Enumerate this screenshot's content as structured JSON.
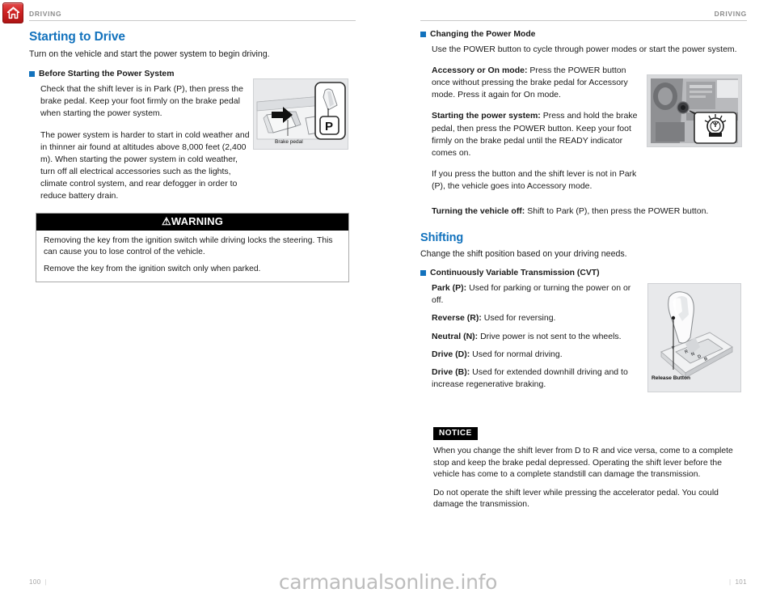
{
  "home_button": {
    "icon": "home-icon",
    "color": "#cf2222"
  },
  "accent_color": "#1272bd",
  "left_page": {
    "running_head": "DRIVING",
    "title": "Starting to Drive",
    "lead": "Turn on the vehicle and start the power system to begin driving.",
    "subsection": {
      "heading": "Before Starting the Power System",
      "paragraphs": [
        "Check that the shift lever is in Park (P), then press the brake pedal. Keep your foot firmly on the brake pedal when starting the power system.",
        "The power system is harder to start in cold weather and in thinner air found at altitudes above 8,000 feet (2,400 m). When starting the power system in cold weather, turn off all electrical accessories such as the lights, climate control system, and rear defogger in order to reduce battery drain."
      ]
    },
    "figure": {
      "name": "brake-pedal-illustration",
      "caption": "Brake pedal",
      "inset_label": "P"
    },
    "warning": {
      "label": "WARNING",
      "symbol": "⚠",
      "paragraphs": [
        "Removing the key from the ignition switch while driving locks the steering. This can cause you to lose control of the vehicle.",
        "Remove the key from the ignition switch only when parked."
      ]
    },
    "page_number": "100"
  },
  "right_page": {
    "running_head": "DRIVING",
    "power_mode": {
      "heading": "Changing the Power Mode",
      "lead": "Use the POWER button to cycle through power modes or start the power system.",
      "items": [
        {
          "term": "Accessory or On mode:",
          "text": " Press the POWER button once without pressing the brake pedal for Accessory mode. Press it again for On mode."
        },
        {
          "term": "Starting the power system:",
          "text": " Press and hold the brake pedal, then press the POWER button. Keep your foot firmly on the brake pedal until the READY indicator comes on."
        }
      ],
      "note": "If you press the button and the shift lever is not in Park (P), the vehicle goes into Accessory mode.",
      "turning_off": {
        "term": "Turning the vehicle off:",
        "text": " Shift to Park (P), then press the POWER button."
      },
      "figure": {
        "name": "power-button-dashboard-photo"
      }
    },
    "shifting": {
      "title": "Shifting",
      "lead": "Change the shift position based on your driving needs.",
      "heading": "Continuously Variable Transmission (CVT)",
      "positions": [
        {
          "term": "Park (P):",
          "text": " Used for parking or turning the power on or off."
        },
        {
          "term": "Reverse (R):",
          "text": " Used for reversing."
        },
        {
          "term": "Neutral (N):",
          "text": " Drive power is not sent to the wheels."
        },
        {
          "term": "Drive (D):",
          "text": " Used for normal driving."
        },
        {
          "term": "Drive (B):",
          "text": " Used for extended downhill driving and to increase regenerative braking."
        }
      ],
      "figure": {
        "name": "shift-lever-illustration",
        "caption": "Release Button",
        "gate_labels": "P R N D B"
      }
    },
    "notice": {
      "label": "NOTICE",
      "paragraphs": [
        "When you change the shift lever from D to R and vice versa, come to a complete stop and keep the brake pedal depressed. Operating the shift lever before the vehicle has come to a complete standstill can damage the transmission.",
        "Do not operate the shift lever while pressing the accelerator pedal. You could damage the transmission."
      ]
    },
    "page_number": "101"
  },
  "watermark": "carmanualsonline.info"
}
